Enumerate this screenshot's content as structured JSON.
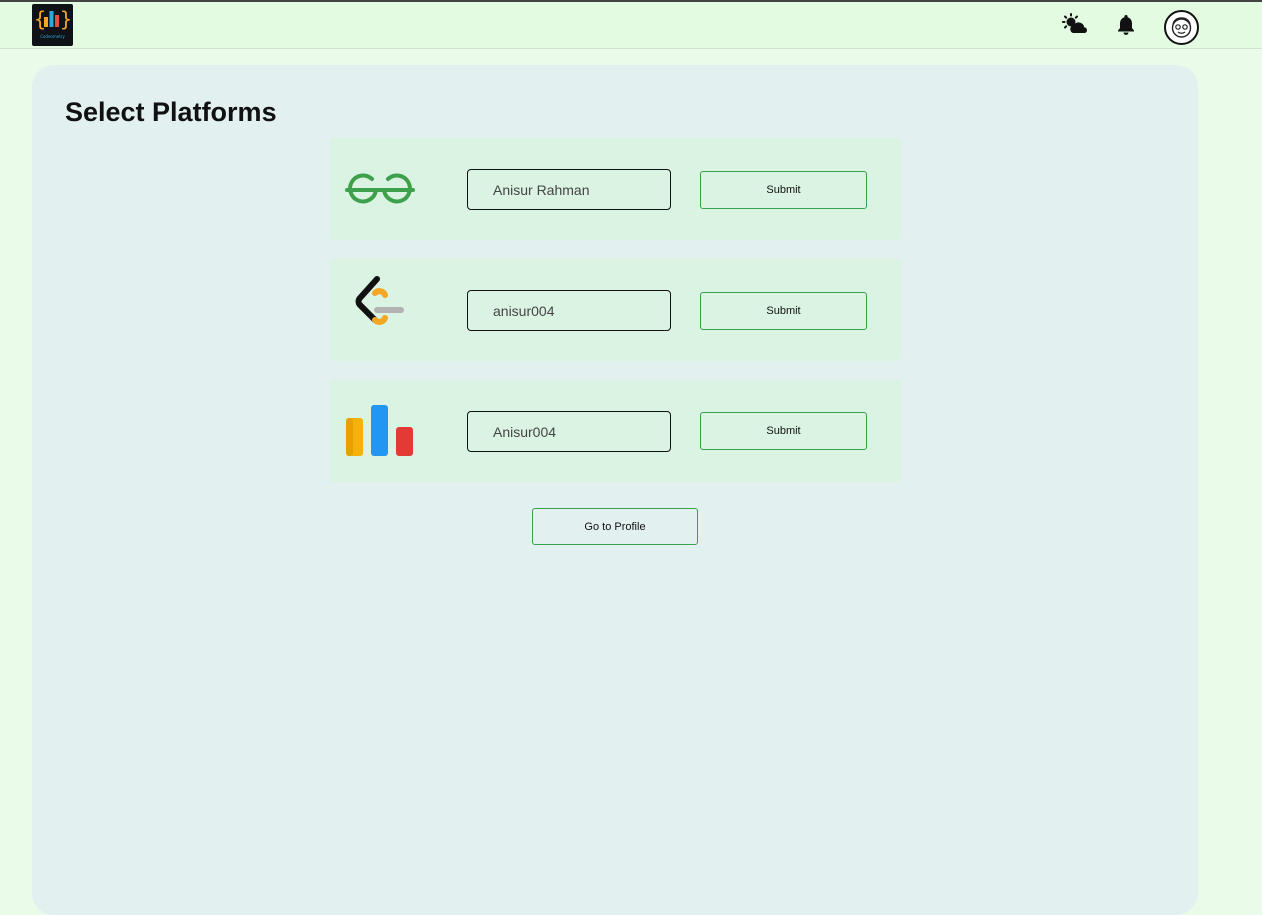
{
  "navbar": {
    "logo_text": "Codeometry",
    "icons": [
      "weather-icon",
      "bell-icon",
      "avatar"
    ]
  },
  "page": {
    "title": "Select Platforms"
  },
  "platforms": [
    {
      "name_icon": "geeksforgeeks-logo-icon",
      "input_value": "Anisur Rahman",
      "submit_label": "Submit"
    },
    {
      "name_icon": "leetcode-logo-icon",
      "input_value": "anisur004",
      "submit_label": "Submit"
    },
    {
      "name_icon": "codechef-bars-logo-icon",
      "input_value": "Anisur004",
      "submit_label": "Submit"
    }
  ],
  "profile_button": "Go to Profile",
  "colors": {
    "page_bg": "#ebfbe9",
    "navbar_bg": "#e2fbe1",
    "panel_bg": "#e2f0ef",
    "card_bg": "#dbf3e3",
    "button_border": "#36a34a",
    "gfg_green": "#3fa04c"
  }
}
